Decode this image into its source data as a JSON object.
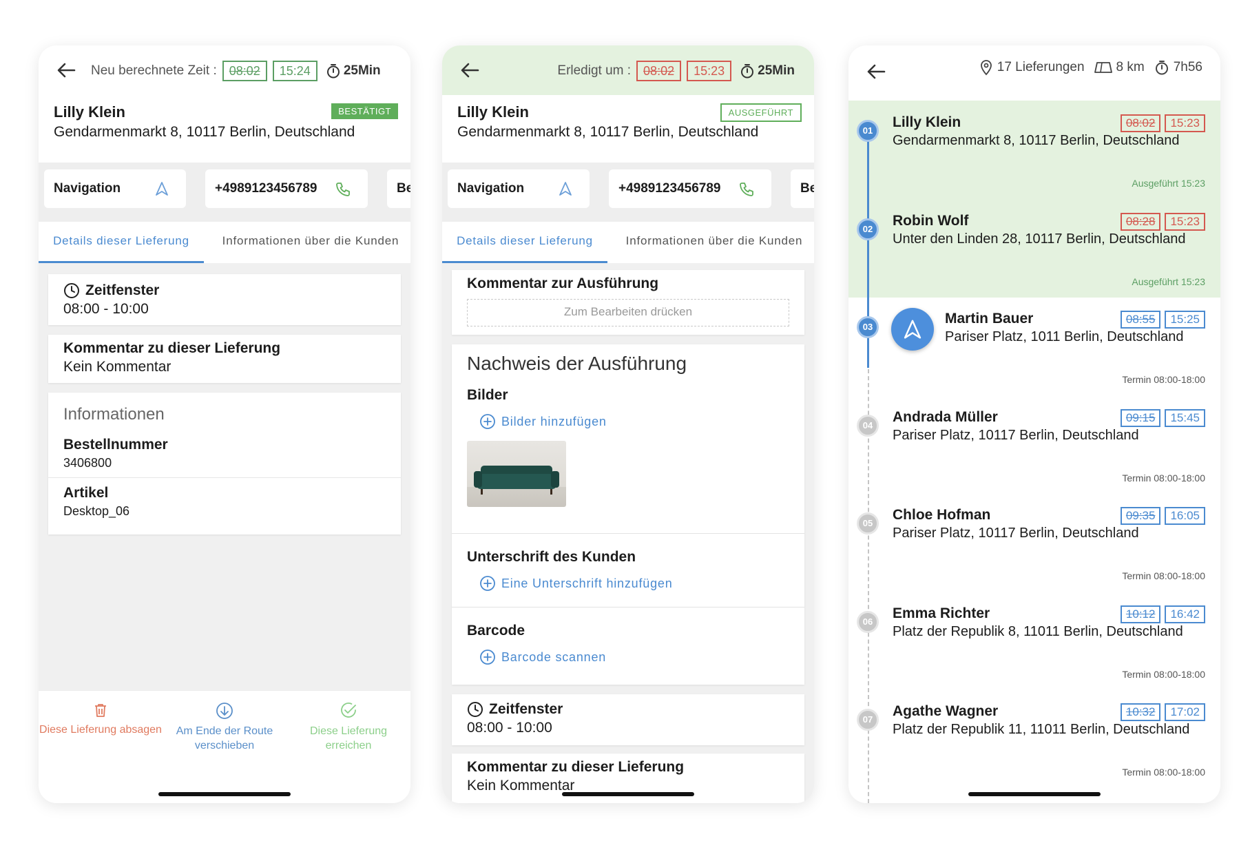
{
  "colors": {
    "green": "#5b9e63",
    "red": "#d4584f",
    "blue": "#4a8ad0",
    "done_bg": "#e4f2df",
    "header_done_bg": "#e4f2df"
  },
  "screen1": {
    "header_label": "Neu berechnete Zeit :",
    "time_old": "08:02",
    "time_new": "15:24",
    "duration": "25Min",
    "customer_name": "Lilly Klein",
    "customer_address": "Gendarmenmarkt 8, 10117 Berlin, Deutschland",
    "status_badge": "BESTÄTIGT",
    "nav_label": "Navigation",
    "phone": "+4989123456789",
    "third_btn_partial": "Be",
    "tab_details": "Details dieser Lieferung",
    "tab_customer": "Informationen über die Kunden",
    "timewindow_title": "Zeitfenster",
    "timewindow_value": "08:00 - 10:00",
    "comment_title": "Kommentar zu dieser Lieferung",
    "comment_value": "Kein Kommentar",
    "info_title": "Informationen",
    "order_label": "Bestellnummer",
    "order_value": "3406800",
    "article_label": "Artikel",
    "article_value": "Desktop_06",
    "footer_cancel": "Diese Lieferung absagen",
    "footer_move": "Am Ende der Route verschieben",
    "footer_reach": "Diese Lieferung erreichen"
  },
  "screen2": {
    "header_label": "Erledigt um :",
    "time_old": "08:02",
    "time_new": "15:23",
    "duration": "25Min",
    "customer_name": "Lilly Klein",
    "customer_address": "Gendarmenmarkt 8, 10117 Berlin, Deutschland",
    "status_badge": "AUSGEFÜHRT",
    "nav_label": "Navigation",
    "phone": "+4989123456789",
    "third_btn_partial": "Be",
    "tab_details": "Details dieser Lieferung",
    "tab_customer": "Informationen über die Kunden",
    "exec_comment_title": "Kommentar zur Ausführung",
    "exec_comment_placeholder": "Zum Bearbeiten drücken",
    "proof_title": "Nachweis der Ausführung",
    "images_label": "Bilder",
    "images_add": "Bilder hinzufügen",
    "signature_label": "Unterschrift des Kunden",
    "signature_add": "Eine Unterschrift hinzufügen",
    "barcode_label": "Barcode",
    "barcode_scan": "Barcode scannen",
    "timewindow_title": "Zeitfenster",
    "timewindow_value": "08:00 - 10:00",
    "comment_title": "Kommentar zu dieser Lieferung",
    "comment_value": "Kein Kommentar"
  },
  "screen3": {
    "deliveries": "17 Lieferungen",
    "distance": "8 km",
    "duration": "7h56",
    "stops": [
      {
        "num": "01",
        "name": "Lilly Klein",
        "address": "Gendarmenmarkt 8, 10117 Berlin, Deutschland",
        "planned": "08:02",
        "actual": "15:23",
        "status": "Ausgeführt 15:23",
        "state": "done"
      },
      {
        "num": "02",
        "name": "Robin Wolf",
        "address": "Unter den Linden 28, 10117 Berlin, Deutschland",
        "planned": "08:28",
        "actual": "15:23",
        "status": "Ausgeführt 15:23",
        "state": "done"
      },
      {
        "num": "03",
        "name": "Martin Bauer",
        "address": "Pariser Platz, 1011 Berlin, Deutschland",
        "planned": "08:55",
        "actual": "15:25",
        "status": "Termin 08:00-18:00",
        "state": "current"
      },
      {
        "num": "04",
        "name": "Andrada Müller",
        "address": "Pariser Platz, 10117 Berlin, Deutschland",
        "planned": "09:15",
        "actual": "15:45",
        "status": "Termin 08:00-18:00",
        "state": "pending"
      },
      {
        "num": "05",
        "name": "Chloe Hofman",
        "address": "Pariser Platz, 10117 Berlin, Deutschland",
        "planned": "09:35",
        "actual": "16:05",
        "status": "Termin 08:00-18:00",
        "state": "pending"
      },
      {
        "num": "06",
        "name": "Emma Richter",
        "address": "Platz der Republik 8, 11011 Berlin, Deutschland",
        "planned": "10:12",
        "actual": "16:42",
        "status": "Termin 08:00-18:00",
        "state": "pending"
      },
      {
        "num": "07",
        "name": "Agathe Wagner",
        "address": "Platz der Republik 11, 11011 Berlin, Deutschland",
        "planned": "10:32",
        "actual": "17:02",
        "status": "Termin 08:00-18:00",
        "state": "pending"
      }
    ]
  }
}
